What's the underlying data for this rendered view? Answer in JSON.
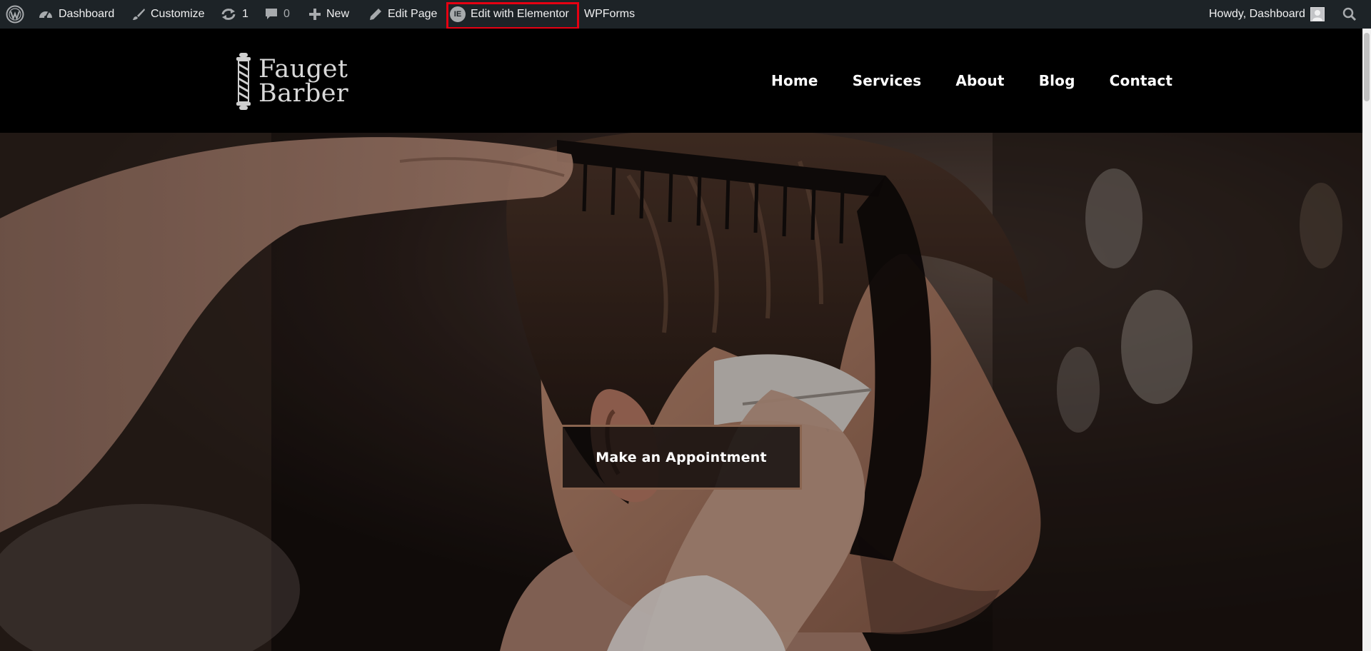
{
  "admin_bar": {
    "dashboard": "Dashboard",
    "customize": "Customize",
    "updates_count": "1",
    "comments_count": "0",
    "new": "New",
    "edit_page": "Edit Page",
    "edit_with_elementor": "Edit with Elementor",
    "wpforms": "WPForms",
    "howdy": "Howdy, Dashboard",
    "icons": [
      "wordpress-logo-icon",
      "dashboard-gauge-icon",
      "brush-icon",
      "updates-icon",
      "comment-icon",
      "plus-icon",
      "pencil-icon",
      "elementor-icon",
      "avatar-icon",
      "search-icon"
    ],
    "highlight_color": "#e60012"
  },
  "site": {
    "logo_line1": "Fauget",
    "logo_line2": "Barber",
    "nav": [
      {
        "label": "Home"
      },
      {
        "label": "Services"
      },
      {
        "label": "About"
      },
      {
        "label": "Blog"
      },
      {
        "label": "Contact"
      }
    ]
  },
  "hero": {
    "cta_label": "Make an Appointment",
    "cta_border_color": "#8a6550"
  }
}
